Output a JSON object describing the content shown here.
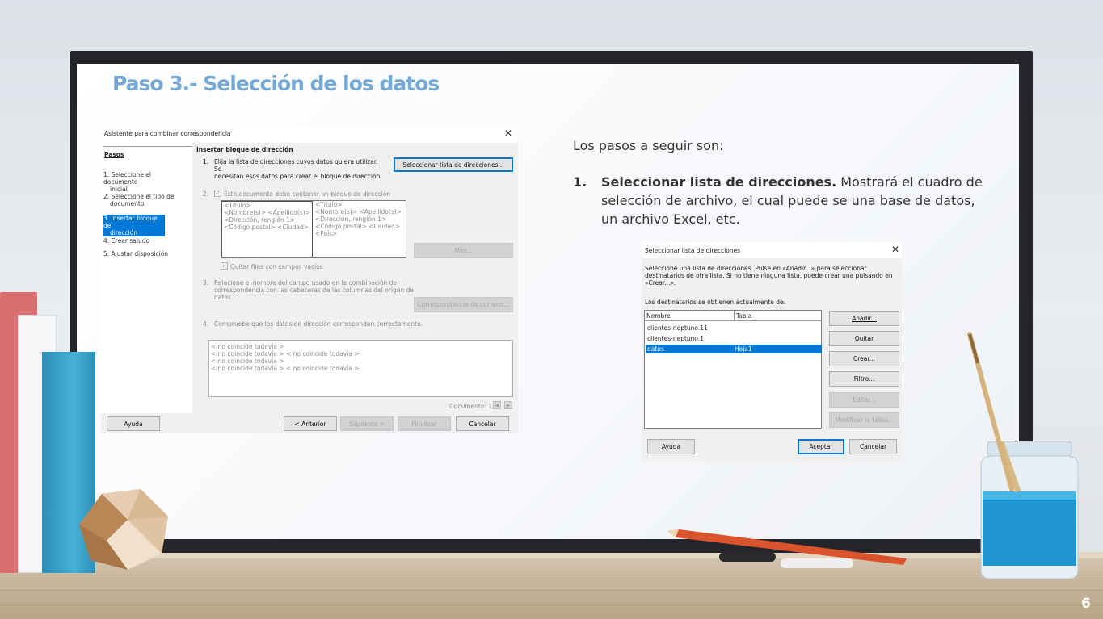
{
  "slide": {
    "title": "Paso 3.- Selección de los datos",
    "page_number": "6"
  },
  "dialog_wizard": {
    "window_title": "Asistente para combinar correspondencia",
    "steps_header": "Pasos",
    "steps": [
      {
        "line1": "1. Seleccione el documento",
        "line2": "inicial"
      },
      {
        "line1": "2. Seleccione el tipo de",
        "line2": "documento"
      },
      {
        "line1": "3. Insertar bloque de",
        "line2": "dirección"
      },
      {
        "line1": "4. Crear saludo",
        "line2": ""
      },
      {
        "line1": "5. Ajustar disposición",
        "line2": ""
      }
    ],
    "section_title": "Insertar bloque de dirección",
    "item1_num": "1.",
    "item1_line1": "Elija la lista de direcciones cuyos datos quiera utilizar. Se",
    "item1_line2": "necesitan esos datos para crear el bloque de dirección.",
    "select_list_button": "Seleccionar lista de direcciones...",
    "item2_num": "2.",
    "item2_text": "Este documento debe contener un bloque de dirección",
    "block_left": [
      "<Título>",
      "<Nombre(s)> <Apellido(s)>",
      "<Dirección, renglón 1>",
      "<Código postal> <Ciudad>"
    ],
    "block_right": [
      "<Título>",
      "<Nombre(s)> <Apellido(s)>",
      "<Dirección, renglón 1>",
      "<Código postal> <Ciudad>",
      "<País>"
    ],
    "more_button": "Más...",
    "remove_empty_label": "Quitar filas con campos vacíos",
    "item3_num": "3.",
    "item3_line1": "Relacione el nombre del campo usado en la combinación de",
    "item3_line2": "correspondencia con las cabeceras de las columnas del origen de",
    "item3_line3": "datos.",
    "field_match_button": "Correspondencia de campos...",
    "item4_num": "4.",
    "item4_text": "Compruebe que los datos de dirección correspondan correctamente.",
    "preview_lines": [
      "< no coincide todavía >",
      "< no coincide todavía > < no coincide todavía >",
      "< no coincide todavía >",
      "< no coincide todavía > < no coincide todavía >"
    ],
    "document_label": "Documento: 1",
    "help_button": "Ayuda",
    "back_button": "< Anterior",
    "next_button": "Siguiente >",
    "finish_button": "Finalizar",
    "cancel_button": "Cancelar"
  },
  "text": {
    "intro": "Los pasos a seguir son:",
    "step_num": "1.",
    "step_bold": "Seleccionar lista de direcciones.",
    "step_rest_1": " Mostrará el cuadro de",
    "step_line2": "selección de archivo, el cual puede se una base de datos,",
    "step_line3": "un archivo Excel, etc."
  },
  "dialog_list": {
    "window_title": "Seleccionar lista de direcciones",
    "desc_line1": "Seleccione una lista de direcciones. Pulse en «Añadir...» para seleccionar",
    "desc_line2": "destinatarios de otra lista. Si no tiene ninguna lista, puede crear una pulsando en",
    "desc_line3": "«Crear...».",
    "current_label": "Los destinatarios se obtienen actualmente de:",
    "col_name": "Nombre",
    "col_table": "Tabla",
    "rows": [
      {
        "name": "clientes-neptuno.11",
        "table": ""
      },
      {
        "name": "clientes-neptuno.1",
        "table": ""
      },
      {
        "name": "datos",
        "table": "Hoja1"
      }
    ],
    "add_button": "Añadir...",
    "remove_button": "Quitar",
    "create_button": "Crear...",
    "filter_button": "Filtro...",
    "edit_button": "Editar...",
    "modify_table_button": "Modificar la tabla...",
    "help_button": "Ayuda",
    "accept_button": "Aceptar",
    "cancel_button": "Cancelar"
  },
  "colors": {
    "title": "#74a8d5",
    "accent": "#0078d7",
    "frame": "#23252a"
  }
}
